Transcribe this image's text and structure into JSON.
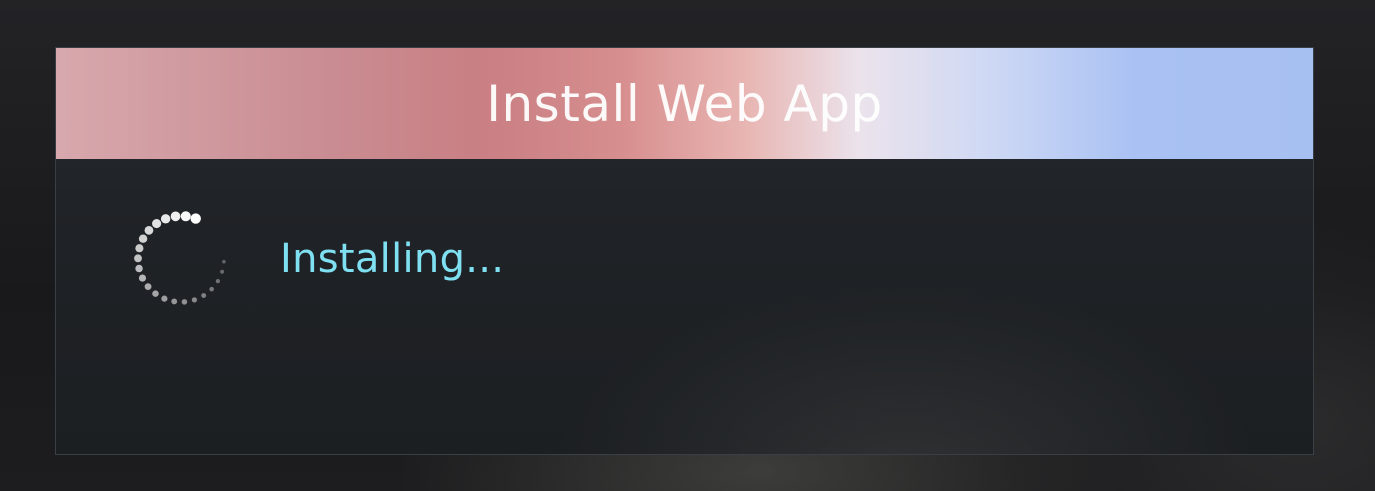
{
  "dialog": {
    "title": "Install Web App",
    "status_text": "Installing...",
    "spinner_icon": "loading-spinner-icon",
    "colors": {
      "status_text": "#7fe0f2",
      "title_text": "#ffffff",
      "title_gradient_start": "#d7a8ad",
      "title_gradient_mid": "#ebe3ec",
      "title_gradient_end": "#a7c0f2"
    }
  }
}
